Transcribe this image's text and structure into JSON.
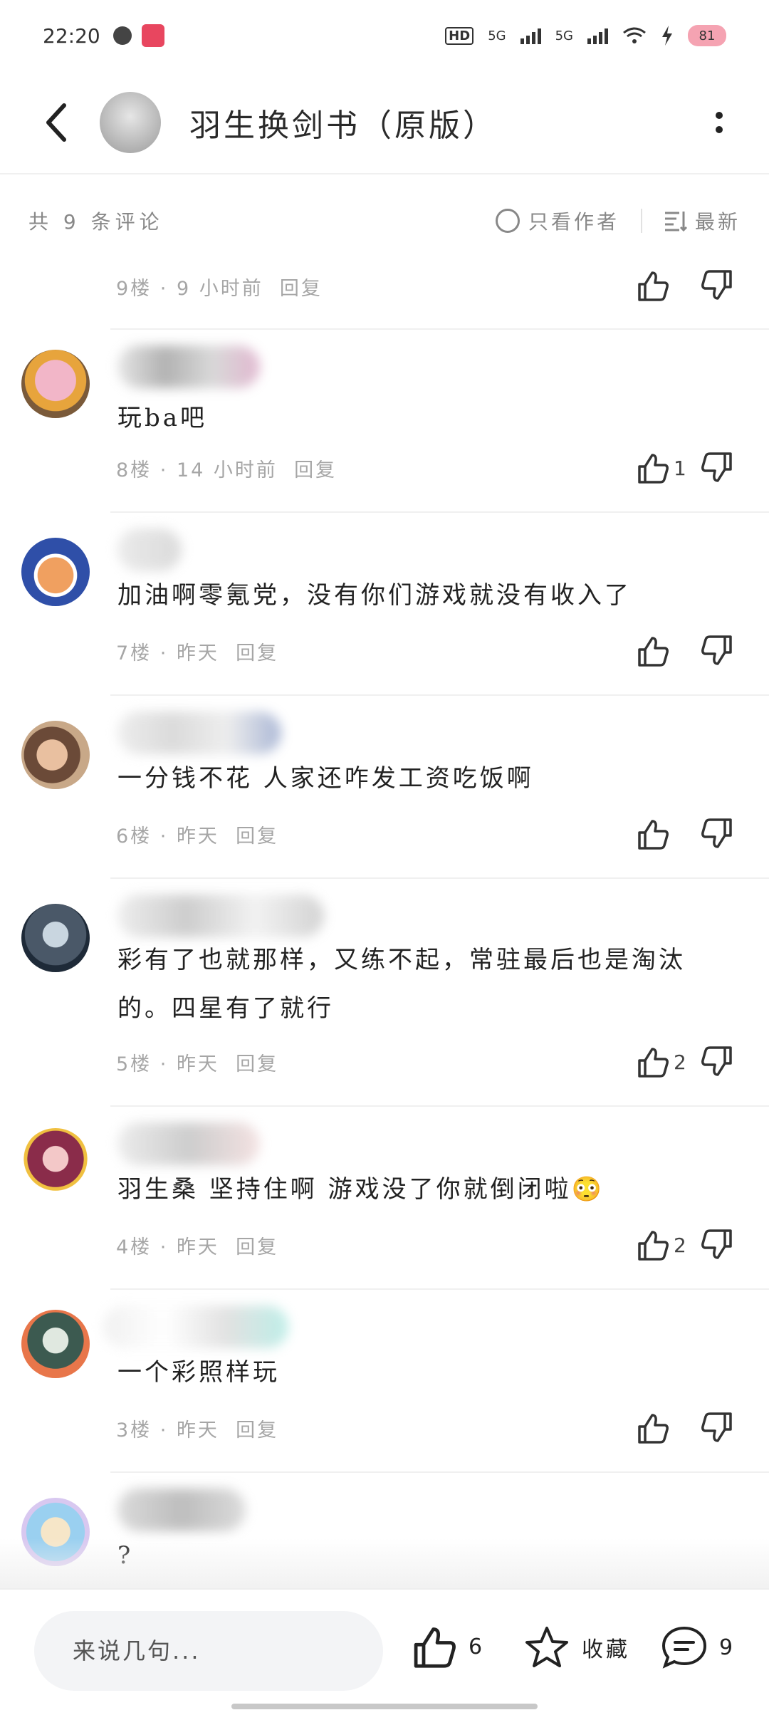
{
  "status_bar": {
    "time": "22:20",
    "network_1": "5G",
    "network_2": "5G",
    "hd_label": "HD",
    "battery": "81"
  },
  "header": {
    "title": "羽生换剑书（原版）",
    "back_icon": "chevron-left-icon",
    "more_icon": "more-vertical-icon"
  },
  "filter": {
    "count_label": "共 9 条评论",
    "author_only_label": "只看作者",
    "sort_label": "最新"
  },
  "comments": [
    {
      "floor": "9楼",
      "time": "9 小时前",
      "reply": "回复",
      "likes": "",
      "text": ""
    },
    {
      "floor": "8楼",
      "time": "14 小时前",
      "reply": "回复",
      "likes": "1",
      "text": "玩ba吧"
    },
    {
      "floor": "7楼",
      "time": "昨天",
      "reply": "回复",
      "likes": "",
      "text": "加油啊零氪党，没有你们游戏就没有收入了"
    },
    {
      "floor": "6楼",
      "time": "昨天",
      "reply": "回复",
      "likes": "",
      "text": "一分钱不花 人家还咋发工资吃饭啊"
    },
    {
      "floor": "5楼",
      "time": "昨天",
      "reply": "回复",
      "likes": "2",
      "text": "彩有了也就那样，又练不起，常驻最后也是淘汰的。四星有了就行"
    },
    {
      "floor": "4楼",
      "time": "昨天",
      "reply": "回复",
      "likes": "2",
      "text": "羽生桑 坚持住啊 游戏没了你就倒闭啦😳"
    },
    {
      "floor": "3楼",
      "time": "昨天",
      "reply": "回复",
      "likes": "",
      "text": "一个彩照样玩"
    },
    {
      "floor": "",
      "time": "",
      "reply": "",
      "likes": "",
      "text": "?"
    }
  ],
  "bottom_bar": {
    "input_placeholder": "来说几句...",
    "like_count": "6",
    "favorite_label": "收藏",
    "comment_count": "9"
  },
  "colors": {
    "text_primary": "#222222",
    "text_secondary": "#a6a6a6",
    "divider": "#f0f0f0",
    "input_bg": "#f3f4f6"
  }
}
